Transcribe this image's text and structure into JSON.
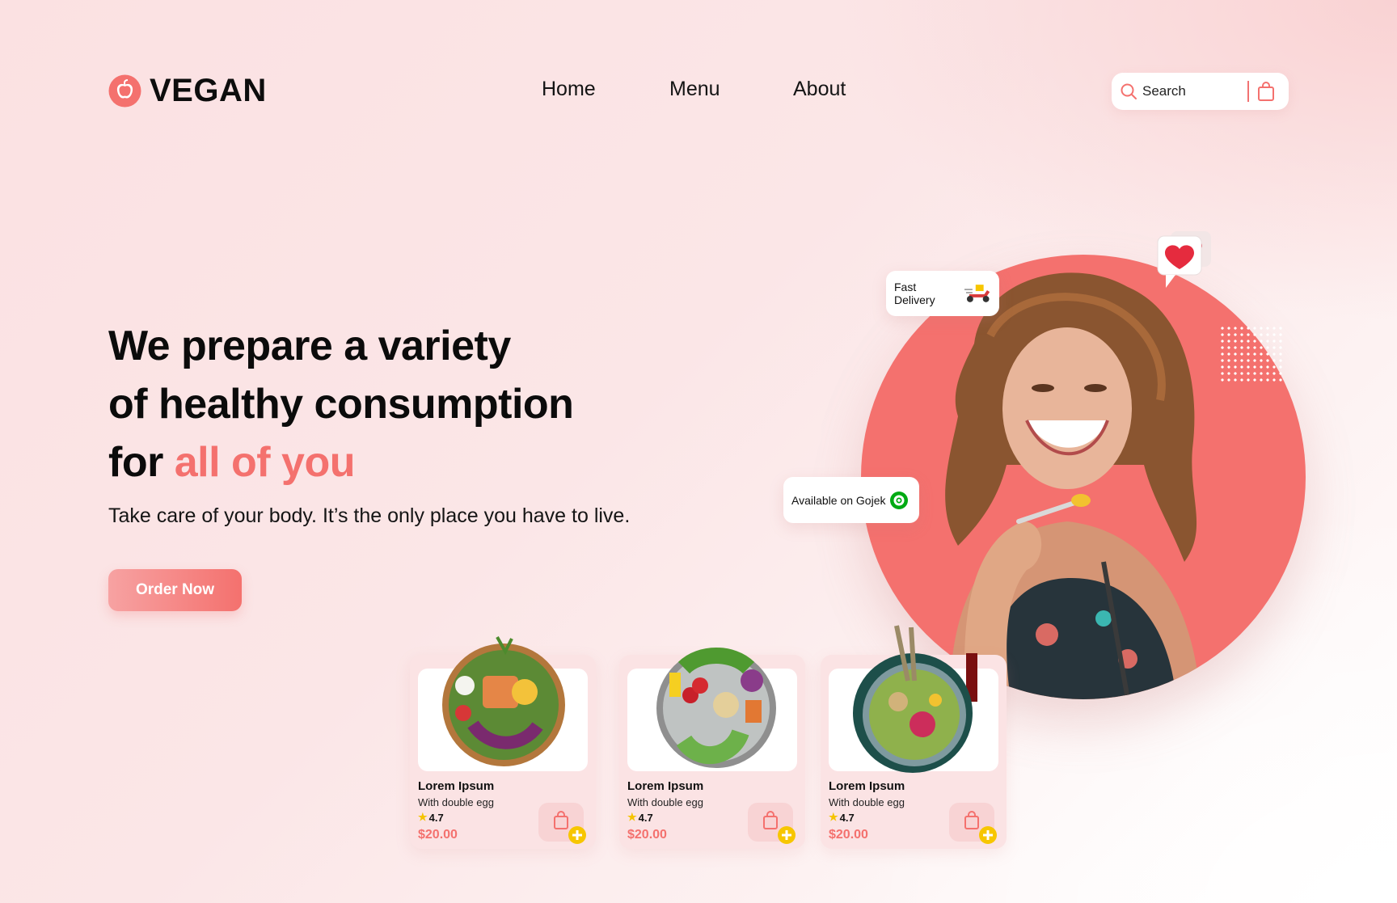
{
  "brand": {
    "name": "VEGAN",
    "logo_icon": "apple-icon",
    "accent_color": "#f4716e"
  },
  "nav": {
    "items": [
      "Home",
      "Menu",
      "About"
    ]
  },
  "search": {
    "placeholder": "Search"
  },
  "hero": {
    "title_line1": "We prepare a variety",
    "title_line2": "of healthy consumption",
    "title_line3_prefix": "for ",
    "title_line3_accent": "all of you",
    "subtitle": "Take care of your body. It’s the only place you have to live.",
    "cta": "Order Now"
  },
  "badges": {
    "delivery": "Fast Delivery",
    "gojek": "Available on Gojek"
  },
  "cards": [
    {
      "name": "Lorem Ipsum",
      "desc": "With double egg",
      "rating": "4.7",
      "price": "$20.00"
    },
    {
      "name": "Lorem Ipsum",
      "desc": "With double egg",
      "rating": "4.7",
      "price": "$20.00"
    },
    {
      "name": "Lorem Ipsum",
      "desc": "With double egg",
      "rating": "4.7",
      "price": "$20.00"
    }
  ]
}
